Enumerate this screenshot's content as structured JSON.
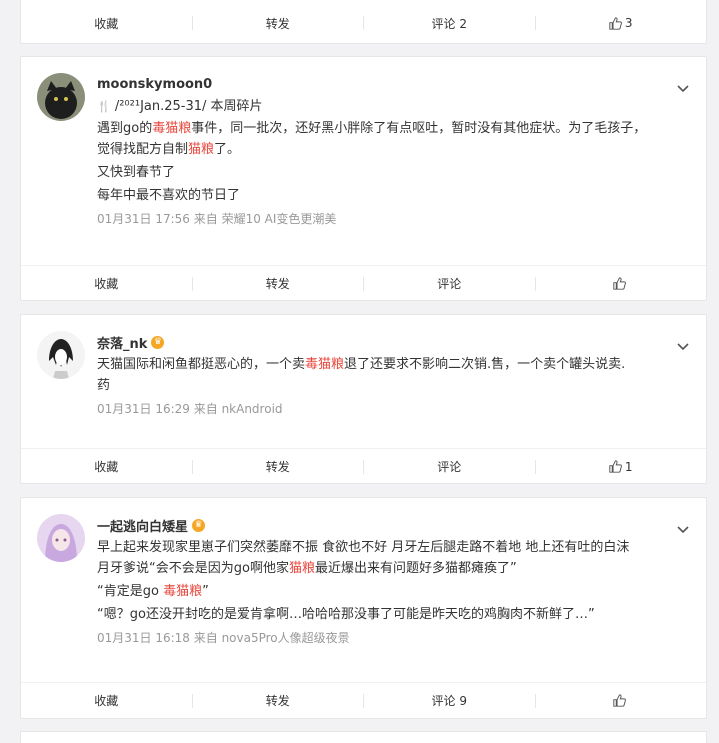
{
  "top_actions": {
    "collect": "收藏",
    "repost": "转发",
    "comment": "评论 2",
    "like": "3"
  },
  "posts": [
    {
      "username": "moonskymoon0",
      "badge_line": "/²⁰²¹Jan.25-31/ 本周碎片",
      "badge_icon": "🍴",
      "lines": [
        {
          "pre": "遇到go的",
          "hl": "毒猫粮",
          "post": "事件，同一批次，还好黑小胖除了有点呕吐，暂时没有其他症状。为了毛孩子，"
        },
        {
          "pre": "觉得找配方自制",
          "hl": "猫粮",
          "post": "了。"
        },
        {
          "pre": "又快到春节了",
          "hl": "",
          "post": ""
        },
        {
          "pre": "每年中最不喜欢的节日了",
          "hl": "",
          "post": ""
        }
      ],
      "meta": "01月31日 17:56  来自 荣耀10 AI变色更潮美",
      "actions": {
        "collect": "收藏",
        "repost": "转发",
        "comment": "评论",
        "like": ""
      }
    },
    {
      "username": "奈落_nk",
      "lines": [
        {
          "pre": "天猫国际和闲鱼都挺恶心的，一个卖",
          "hl": "毒猫粮",
          "post": "退了还要求不影响二次销.售，一个卖个罐头说卖."
        },
        {
          "pre": "药",
          "hl": "",
          "post": ""
        }
      ],
      "meta": "01月31日 16:29  来自 nkAndroid",
      "actions": {
        "collect": "收藏",
        "repost": "转发",
        "comment": "评论",
        "like": "1"
      }
    },
    {
      "username": "一起逃向白矮星",
      "lines": [
        {
          "pre": "早上起来发现家里崽子们突然萎靡不振 食欲也不好 月牙左后腿走路不着地 地上还有吐的白沫",
          "hl": "",
          "post": ""
        },
        {
          "pre": "月牙爹说“会不会是因为go啊他家",
          "hl": "猫粮",
          "post": "最近爆出来有问题好多猫都瘫痪了”"
        },
        {
          "pre": "“肯定是go ",
          "hl": "毒猫粮",
          "post": "”"
        },
        {
          "pre": "“嗯？go还没开封吃的是爱肯拿啊…哈哈哈那没事了可能是昨天吃的鸡胸肉不新鲜了…”",
          "hl": "",
          "post": ""
        }
      ],
      "meta": "01月31日 16:18  来自 nova5Pro人像超级夜景",
      "actions": {
        "collect": "收藏",
        "repost": "转发",
        "comment": "评论 9",
        "like": ""
      }
    }
  ],
  "colors": {
    "highlight": "#e8463b",
    "meta": "#999999",
    "crown": "#f5a623"
  }
}
